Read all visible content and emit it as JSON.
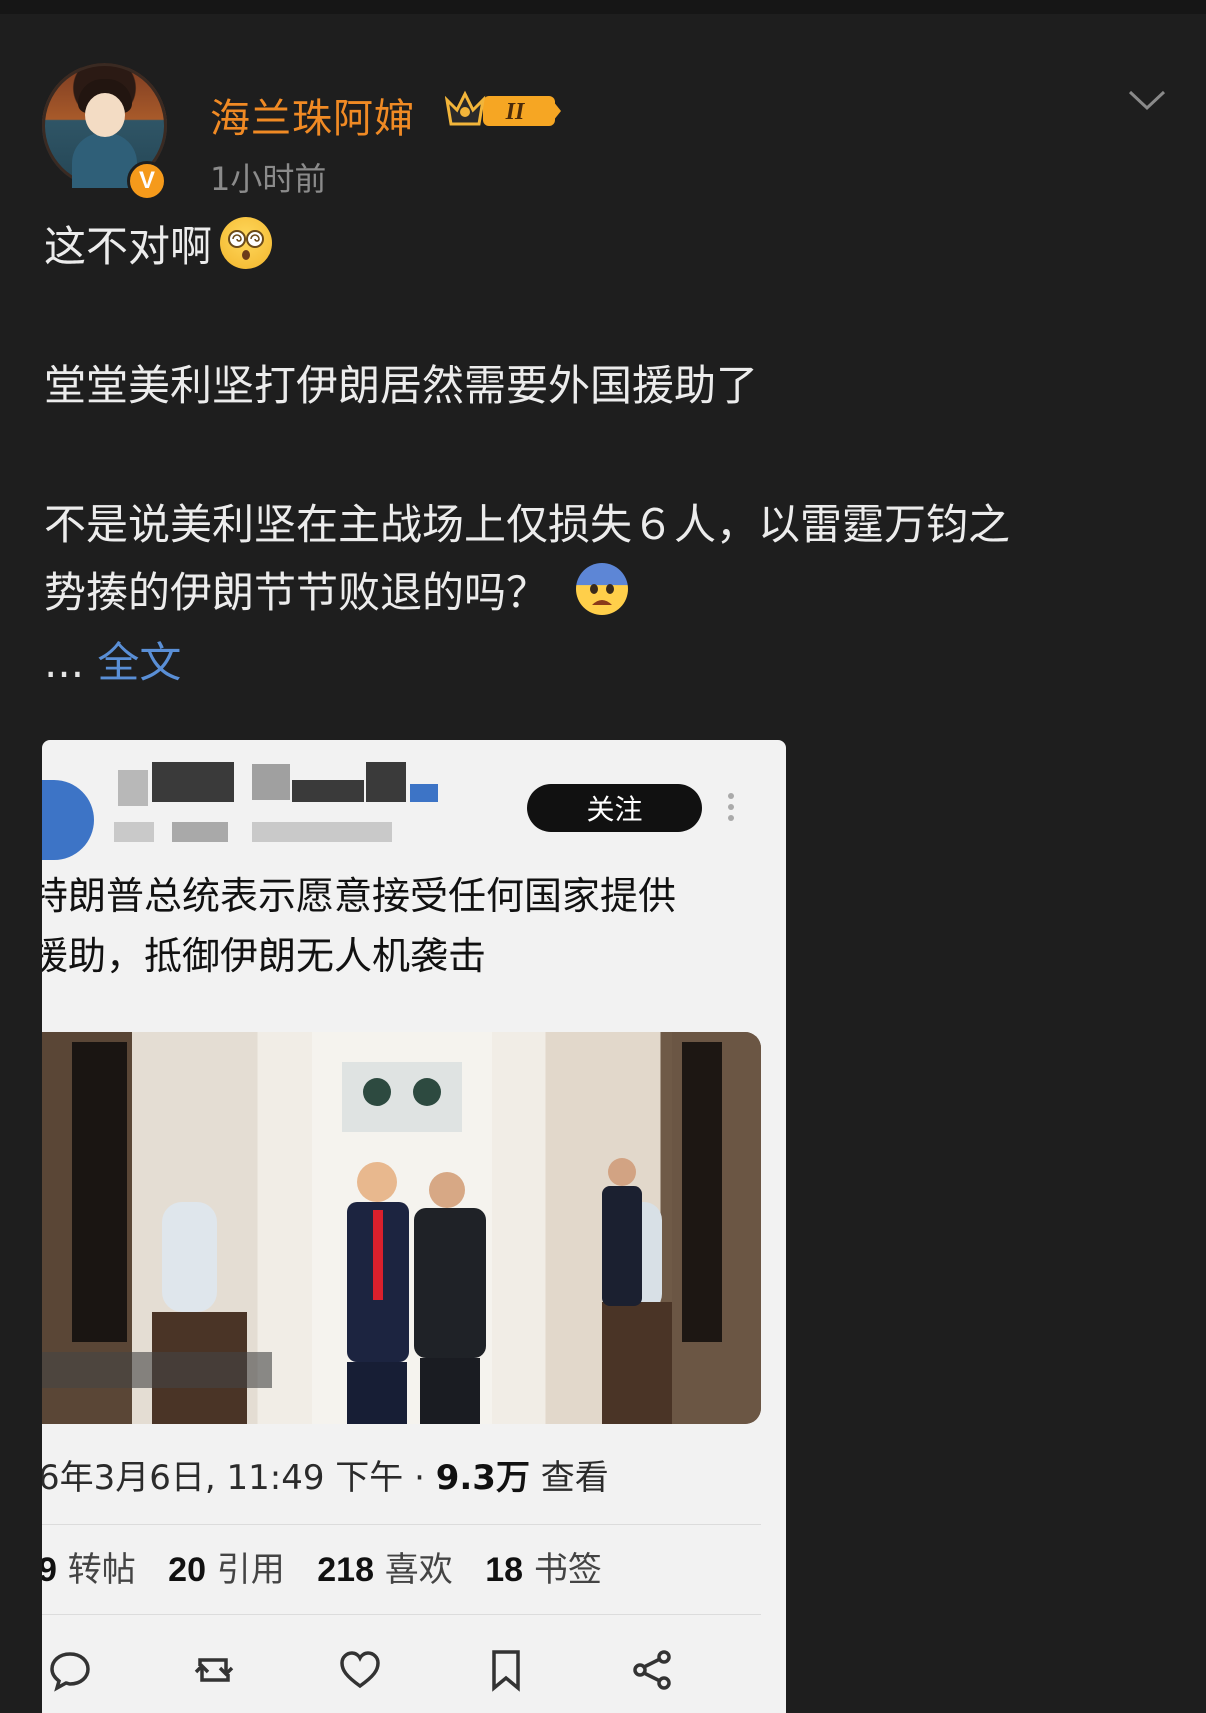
{
  "post": {
    "author": "海兰珠阿婶",
    "level_badge": "II",
    "verified_badge": "V",
    "time": "1小时前",
    "lines": [
      "这不对啊",
      "堂堂美利坚打伊朗居然需要外国援助了",
      "不是说美利坚在主战场上仅损失６人，以雷霆万钧之",
      "势揍的伊朗节节败退的吗？"
    ],
    "more_prefix": "...",
    "more_link": "全文"
  },
  "quoted": {
    "follow_label": "关注",
    "title_lines": [
      "特朗普总统表示愿意接受任何国家提供",
      "援助，抵御伊朗无人机袭击"
    ],
    "date_text": "6年3月6日, 11:49 下午 · ",
    "views_value": "9.3万",
    "views_label": " 查看",
    "stats": [
      {
        "value": "9",
        "label": " 转帖"
      },
      {
        "value": "20",
        "label": " 引用"
      },
      {
        "value": "218",
        "label": " 喜欢"
      },
      {
        "value": "18",
        "label": " 书签"
      }
    ]
  },
  "colors": {
    "background": "#1e1e1e",
    "username": "#f08a24",
    "link": "#5a8fd6",
    "card": "#f2f2f2"
  },
  "icons": [
    "crown-level-icon",
    "chevron-down-icon",
    "dizzy-face-emoji",
    "fearful-face-emoji",
    "reply-icon",
    "repost-icon",
    "like-icon",
    "bookmark-icon",
    "share-icon",
    "more-vertical-icon"
  ]
}
